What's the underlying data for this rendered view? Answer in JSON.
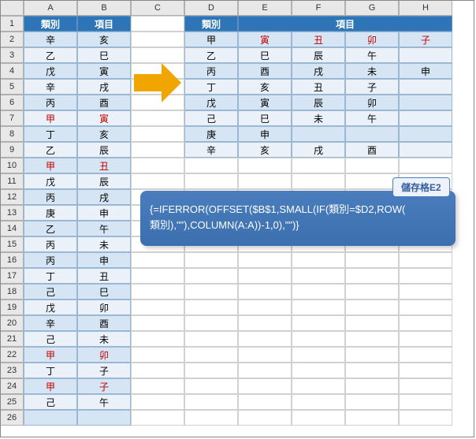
{
  "columns": [
    "A",
    "B",
    "C",
    "D",
    "E",
    "F",
    "G",
    "H"
  ],
  "rows_count": 26,
  "left_table": {
    "headers": [
      "類別",
      "項目"
    ],
    "rows": [
      {
        "a": "辛",
        "b": "亥",
        "red": false
      },
      {
        "a": "乙",
        "b": "巳",
        "red": false
      },
      {
        "a": "戊",
        "b": "寅",
        "red": false
      },
      {
        "a": "辛",
        "b": "戌",
        "red": false
      },
      {
        "a": "丙",
        "b": "酉",
        "red": false
      },
      {
        "a": "甲",
        "b": "寅",
        "red": true
      },
      {
        "a": "丁",
        "b": "亥",
        "red": false
      },
      {
        "a": "乙",
        "b": "辰",
        "red": false
      },
      {
        "a": "甲",
        "b": "丑",
        "red": true
      },
      {
        "a": "戊",
        "b": "辰",
        "red": false
      },
      {
        "a": "丙",
        "b": "戌",
        "red": false
      },
      {
        "a": "庚",
        "b": "申",
        "red": false
      },
      {
        "a": "乙",
        "b": "午",
        "red": false
      },
      {
        "a": "丙",
        "b": "未",
        "red": false
      },
      {
        "a": "丙",
        "b": "申",
        "red": false
      },
      {
        "a": "丁",
        "b": "丑",
        "red": false
      },
      {
        "a": "己",
        "b": "巳",
        "red": false
      },
      {
        "a": "戊",
        "b": "卯",
        "red": false
      },
      {
        "a": "辛",
        "b": "酉",
        "red": false
      },
      {
        "a": "己",
        "b": "未",
        "red": false
      },
      {
        "a": "甲",
        "b": "卯",
        "red": true
      },
      {
        "a": "丁",
        "b": "子",
        "red": false
      },
      {
        "a": "甲",
        "b": "子",
        "red": true
      },
      {
        "a": "己",
        "b": "午",
        "red": false
      }
    ]
  },
  "right_table": {
    "header_left": "類別",
    "header_right": "項目",
    "rows": [
      {
        "d": "甲",
        "vals": [
          "寅",
          "丑",
          "卯",
          "子"
        ],
        "alt": 1,
        "red": true
      },
      {
        "d": "乙",
        "vals": [
          "巳",
          "辰",
          "午",
          ""
        ],
        "alt": 2,
        "red": false
      },
      {
        "d": "丙",
        "vals": [
          "酉",
          "戌",
          "未",
          "申"
        ],
        "alt": 1,
        "red": false
      },
      {
        "d": "丁",
        "vals": [
          "亥",
          "丑",
          "子",
          ""
        ],
        "alt": 2,
        "red": false
      },
      {
        "d": "戊",
        "vals": [
          "寅",
          "辰",
          "卯",
          ""
        ],
        "alt": 1,
        "red": false
      },
      {
        "d": "己",
        "vals": [
          "巳",
          "未",
          "午",
          ""
        ],
        "alt": 2,
        "red": false
      },
      {
        "d": "庚",
        "vals": [
          "申",
          "",
          "",
          ""
        ],
        "alt": 1,
        "red": false
      },
      {
        "d": "辛",
        "vals": [
          "亥",
          "戌",
          "酉",
          ""
        ],
        "alt": 2,
        "red": false
      }
    ]
  },
  "formula": {
    "label": "儲存格E2",
    "line1": "{=IFERROR(OFFSET($B$1,SMALL(IF(類別=$D2,ROW(",
    "line2": "類別),\"\"),COLUMN(A:A))-1,0),\"\")}"
  }
}
